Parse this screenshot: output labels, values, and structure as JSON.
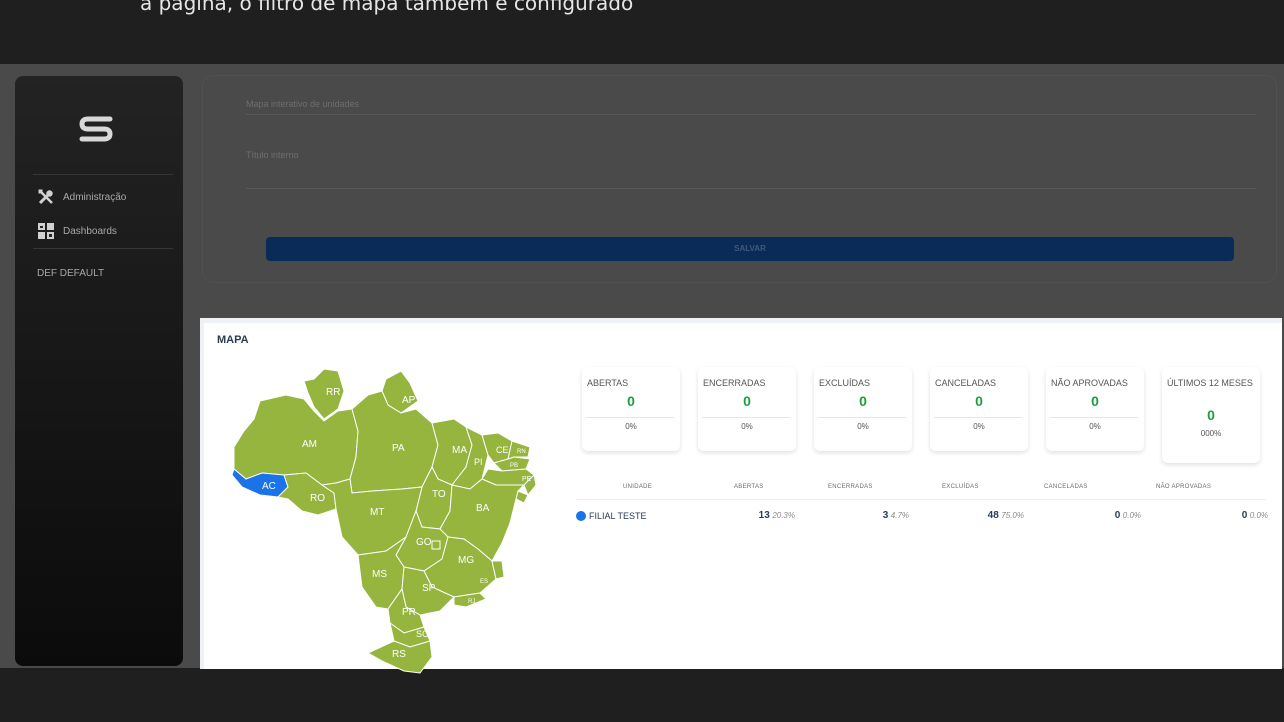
{
  "top_caption": "a página, o filtro de mapa também é configurado",
  "sidebar": {
    "logo_icon": "brand-s-logo",
    "items": [
      {
        "icon": "tools-icon",
        "label": "Administração"
      },
      {
        "icon": "dashboard-icon",
        "label": "Dashboards"
      }
    ],
    "def_label": "DEF  DEFAULT"
  },
  "form": {
    "field1_label": "Mapa interativo de unidades",
    "field2_label": "Título interno",
    "save_label": "SALVAR"
  },
  "map_panel": {
    "title": "MAPA",
    "highlight_color": "#1a73e8",
    "state_color": "#95b53e",
    "states": [
      "RR",
      "AP",
      "AM",
      "PA",
      "MA",
      "CE",
      "RN",
      "PB",
      "PE",
      "AL",
      "SE",
      "PI",
      "AC",
      "RO",
      "TO",
      "BA",
      "MT",
      "GO",
      "DF",
      "MG",
      "ES",
      "MS",
      "SP",
      "RJ",
      "PR",
      "SC",
      "RS"
    ],
    "selected_state": "AC",
    "stats": [
      {
        "label": "ABERTAS",
        "value": "0",
        "pct": "0%"
      },
      {
        "label": "ENCERRADAS",
        "value": "0",
        "pct": "0%"
      },
      {
        "label": "EXCLUÍDAS",
        "value": "0",
        "pct": "0%"
      },
      {
        "label": "CANCELADAS",
        "value": "0",
        "pct": "0%"
      },
      {
        "label": "NÃO APROVADAS",
        "value": "0",
        "pct": "0%"
      },
      {
        "label": "ÚLTIMOS 12 MESES",
        "value": "0",
        "pct": "000%"
      }
    ],
    "table": {
      "headers": [
        "UNIDADE",
        "ABERTAS",
        "ENCERRADAS",
        "EXCLUÍDAS",
        "CANCELADAS",
        "NÃO APROVADAS"
      ],
      "rows": [
        {
          "name": "FILIAL TESTE",
          "cells": [
            {
              "count": "13",
              "pct": "20.3%"
            },
            {
              "count": "3",
              "pct": "4.7%"
            },
            {
              "count": "48",
              "pct": "75.0%"
            },
            {
              "count": "0",
              "pct": "0.0%"
            },
            {
              "count": "0",
              "pct": "0.0%"
            }
          ]
        }
      ]
    }
  }
}
